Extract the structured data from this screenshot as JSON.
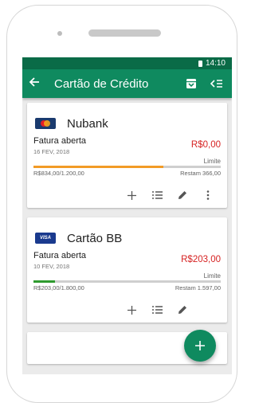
{
  "status": {
    "time": "14:10"
  },
  "toolbar": {
    "title": "Cartão de Crédito"
  },
  "cards": [
    {
      "name": "Nubank",
      "brand": "mastercard",
      "invoice_label": "Fatura aberta",
      "invoice_date": "16 FEV, 2018",
      "amount": "R$0,00",
      "limit_label": "Limite",
      "usage": "R$834,00/1.200,00",
      "remaining": "Restam 366,00",
      "usage_fraction": 0.695,
      "bar_color": "#f29b26"
    },
    {
      "name": "Cartão BB",
      "brand": "visa",
      "brand_text": "VISA",
      "invoice_label": "Fatura aberta",
      "invoice_date": "10 FEV, 2018",
      "amount": "R$203,00",
      "limit_label": "Limite",
      "usage": "R$203,00/1.800,00",
      "remaining": "Restam 1.597,00",
      "usage_fraction": 0.113,
      "bar_color": "#2e9a2e"
    }
  ],
  "colors": {
    "primary": "#0f8a5f",
    "primary_dark": "#0a6b47",
    "amount": "#d62222"
  }
}
